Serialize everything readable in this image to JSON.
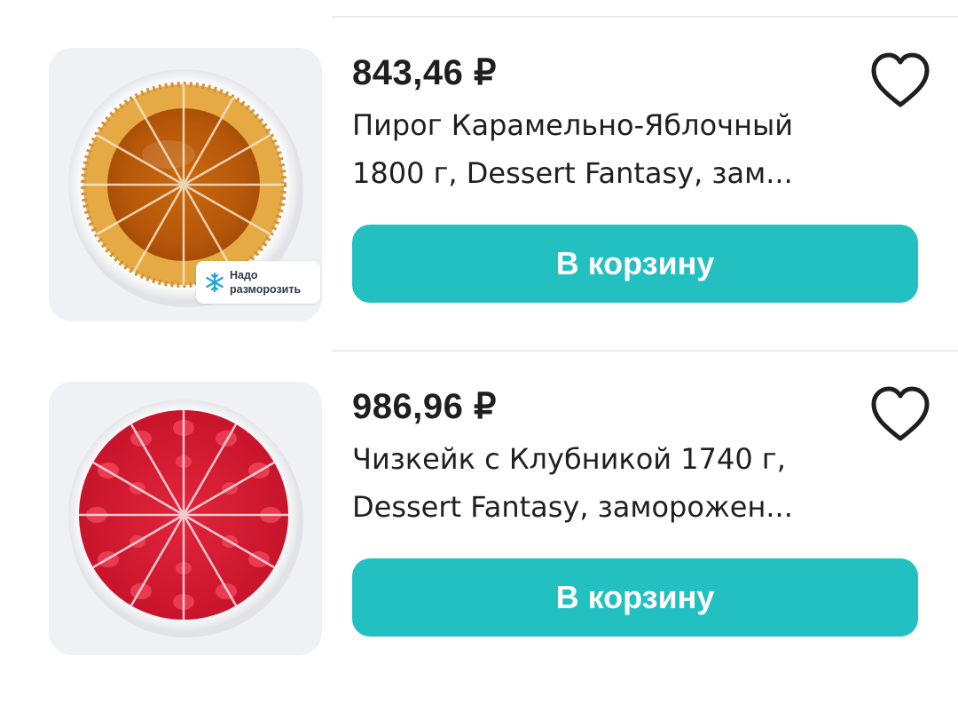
{
  "products": [
    {
      "price": "843,46 ₽",
      "title_line1": "Пирог Карамельно-Яблочный",
      "title_line2": "1800 г, Dessert Fantasy, зам...",
      "badge": "Надо\nразморозить",
      "cart_label": "В корзину",
      "image": "caramel-apple-pie"
    },
    {
      "price": "986,96 ₽",
      "title_line1": "Чизкейк с Клубникой 1740 г,",
      "title_line2": "Dessert Fantasy, заморожен...",
      "cart_label": "В корзину",
      "image": "strawberry-cheesecake"
    }
  ],
  "colors": {
    "accent": "#23c0c2",
    "text": "#1f1f1f",
    "thumb_background": "#eff1f4",
    "divider": "#ececec"
  },
  "icons": {
    "favorite": "heart-outline-icon",
    "badge": "snowflake-icon"
  }
}
